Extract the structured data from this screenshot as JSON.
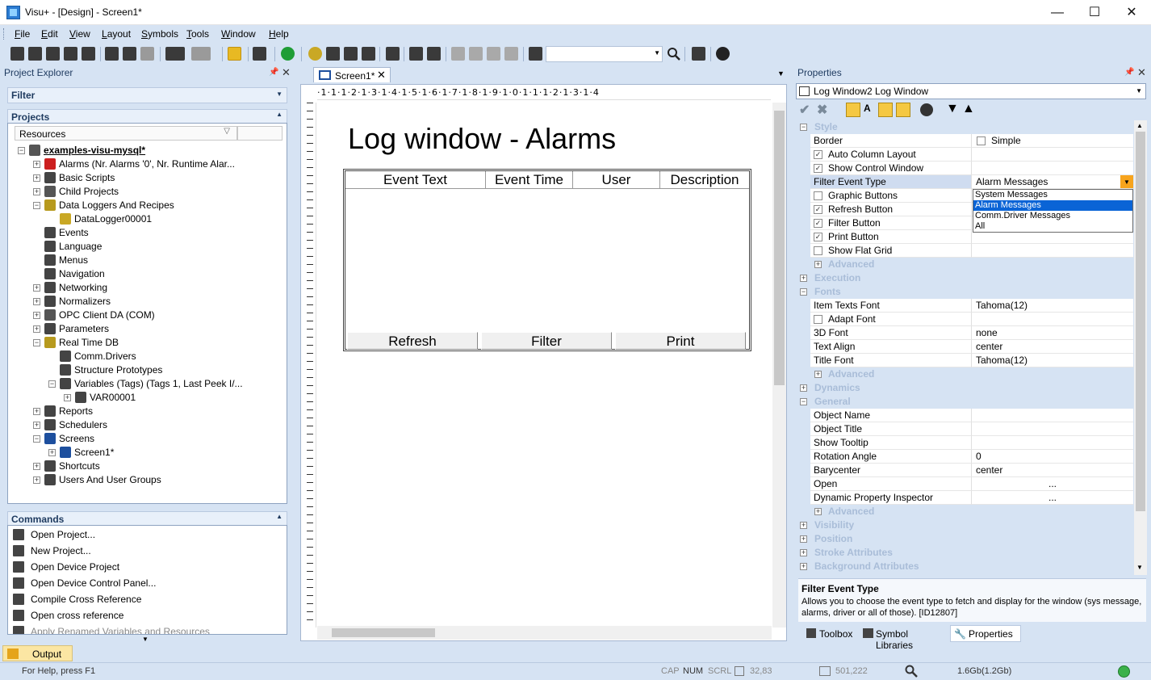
{
  "window": {
    "title": "Visu+ - [Design] - Screen1*",
    "minimize": "—",
    "maximize": "☐",
    "close": "✕"
  },
  "menu": [
    "File",
    "Edit",
    "View",
    "Layout",
    "Symbols",
    "Tools",
    "Window",
    "Help"
  ],
  "project_explorer": {
    "title": "Project Explorer",
    "filter_label": "Filter",
    "projects_label": "Projects",
    "resources_col": "Resources",
    "tree": [
      {
        "label": "examples-visu-mysql*",
        "level": 0,
        "exp": "−",
        "icon": "gear-icon",
        "color": "#555"
      },
      {
        "label": "Alarms (Nr. Alarms '0', Nr. Runtime Alar...",
        "level": 1,
        "exp": "+",
        "icon": "alarm-bell-icon",
        "color": "#cc1f1f"
      },
      {
        "label": "Basic Scripts",
        "level": 1,
        "exp": "+",
        "icon": "script-icon",
        "color": "#444"
      },
      {
        "label": "Child Projects",
        "level": 1,
        "exp": "+",
        "icon": "child-project-icon",
        "color": "#555"
      },
      {
        "label": "Data Loggers And Recipes",
        "level": 1,
        "exp": "−",
        "icon": "database-icon",
        "color": "#b79a1e"
      },
      {
        "label": "DataLogger00001",
        "level": 2,
        "exp": "",
        "icon": "datalogger-icon",
        "color": "#c9a825"
      },
      {
        "label": "Events",
        "level": 1,
        "exp": "",
        "icon": "event-icon",
        "color": "#444"
      },
      {
        "label": "Language",
        "level": 1,
        "exp": "",
        "icon": "language-icon",
        "color": "#444"
      },
      {
        "label": "Menus",
        "level": 1,
        "exp": "",
        "icon": "menu-icon",
        "color": "#444"
      },
      {
        "label": "Navigation",
        "level": 1,
        "exp": "",
        "icon": "navigation-icon",
        "color": "#444"
      },
      {
        "label": "Networking",
        "level": 1,
        "exp": "+",
        "icon": "networking-icon",
        "color": "#444"
      },
      {
        "label": "Normalizers",
        "level": 1,
        "exp": "+",
        "icon": "normalizer-icon",
        "color": "#444"
      },
      {
        "label": "OPC Client DA (COM)",
        "level": 1,
        "exp": "+",
        "icon": "opc-client-icon",
        "color": "#555"
      },
      {
        "label": "Parameters",
        "level": 1,
        "exp": "+",
        "icon": "parameters-icon",
        "color": "#444"
      },
      {
        "label": "Real Time DB",
        "level": 1,
        "exp": "−",
        "icon": "realtime-db-icon",
        "color": "#b79a1e"
      },
      {
        "label": "Comm.Drivers",
        "level": 2,
        "exp": "",
        "icon": "comm-driver-icon",
        "color": "#444"
      },
      {
        "label": "Structure Prototypes",
        "level": 2,
        "exp": "",
        "icon": "structure-icon",
        "color": "#444"
      },
      {
        "label": "Variables (Tags) (Tags 1, Last Peek I/...",
        "level": 2,
        "exp": "−",
        "icon": "variables-icon",
        "color": "#444"
      },
      {
        "label": "VAR00001",
        "level": 3,
        "exp": "+",
        "icon": "variable-icon",
        "color": "#444"
      },
      {
        "label": "Reports",
        "level": 1,
        "exp": "+",
        "icon": "report-icon",
        "color": "#444"
      },
      {
        "label": "Schedulers",
        "level": 1,
        "exp": "+",
        "icon": "scheduler-icon",
        "color": "#444"
      },
      {
        "label": "Screens",
        "level": 1,
        "exp": "−",
        "icon": "screens-icon",
        "color": "#1d4f9e"
      },
      {
        "label": "Screen1*",
        "level": 2,
        "exp": "+",
        "icon": "screen-icon",
        "color": "#1d4f9e"
      },
      {
        "label": "Shortcuts",
        "level": 1,
        "exp": "+",
        "icon": "shortcut-icon",
        "color": "#444"
      },
      {
        "label": "Users And User Groups",
        "level": 1,
        "exp": "+",
        "icon": "users-icon",
        "color": "#444"
      }
    ]
  },
  "commands": {
    "title": "Commands",
    "items": [
      "Open Project...",
      "New Project...",
      "Open Device Project",
      "Open Device Control Panel...",
      "Compile Cross Reference",
      "Open cross reference",
      "Apply Renamed Variables and Resources"
    ]
  },
  "output_tab": "Output",
  "document": {
    "tab_label": "Screen1*",
    "ruler_text": "·1·1·1·2·1·3·1·4·1·5·1·6·1·7·1·8·1·9·1·0·1·1·1·2·1·3·1·4",
    "heading": "Log window - Alarms",
    "columns": [
      "Event Text",
      "Event Time",
      "User",
      "Description"
    ],
    "buttons": [
      "Refresh",
      "Filter",
      "Print"
    ]
  },
  "properties": {
    "title": "Properties",
    "object_selector": "Log Window2 Log Window",
    "groups": {
      "style": "Style",
      "advanced": "Advanced",
      "execution": "Execution",
      "fonts": "Fonts",
      "dynamics": "Dynamics",
      "general": "General",
      "visibility": "Visibility",
      "position": "Position",
      "stroke": "Stroke Attributes",
      "background": "Background Attributes"
    },
    "style_rows": [
      {
        "name": "Border",
        "value": "Simple",
        "checked": false,
        "valcheck": true
      },
      {
        "name": "Auto Column Layout",
        "value": "",
        "checked": true
      },
      {
        "name": "Show Control Window",
        "value": "",
        "checked": true
      },
      {
        "name": "Filter Event Type",
        "value": "Alarm Messages",
        "selected": true
      },
      {
        "name": "Graphic Buttons",
        "value": "",
        "checked": false
      },
      {
        "name": "Refresh Button",
        "value": "",
        "checked": true
      },
      {
        "name": "Filter Button",
        "value": "",
        "checked": true
      },
      {
        "name": "Print Button",
        "value": "",
        "checked": true
      },
      {
        "name": "Show Flat Grid",
        "value": "",
        "checked": false
      }
    ],
    "dropdown_options": [
      "System Messages",
      "Alarm Messages",
      "Comm.Driver Messages",
      "All"
    ],
    "dropdown_selected": 1,
    "fonts_rows": [
      {
        "name": "Item Texts Font",
        "value": "Tahoma(12)"
      },
      {
        "name": "Adapt Font",
        "value": "",
        "checked": false
      },
      {
        "name": "3D Font",
        "value": "none"
      },
      {
        "name": "Text Align",
        "value": "center"
      },
      {
        "name": "Title Font",
        "value": "Tahoma(12)"
      }
    ],
    "general_rows": [
      {
        "name": "Object Name",
        "value": ""
      },
      {
        "name": "Object Title",
        "value": ""
      },
      {
        "name": "Show Tooltip",
        "value": ""
      },
      {
        "name": "Rotation Angle",
        "value": "0"
      },
      {
        "name": "Barycenter",
        "value": "center"
      },
      {
        "name": "Open",
        "value": "..."
      },
      {
        "name": "Dynamic Property Inspector",
        "value": "..."
      }
    ],
    "help_title": "Filter Event Type",
    "help_text": "Allows you to choose the event type to fetch and display for the window (sys message, alarms, driver or all of those). [ID12807]",
    "bottom_tabs": [
      "Toolbox",
      "Symbol Libraries",
      "Properties"
    ]
  },
  "status": {
    "help": "For Help, press F1",
    "caps": "CAP",
    "num": "NUM",
    "scrl": "SCRL",
    "coords": "32,83",
    "size": "501,222",
    "memory": "1.6Gb(1.2Gb)"
  }
}
